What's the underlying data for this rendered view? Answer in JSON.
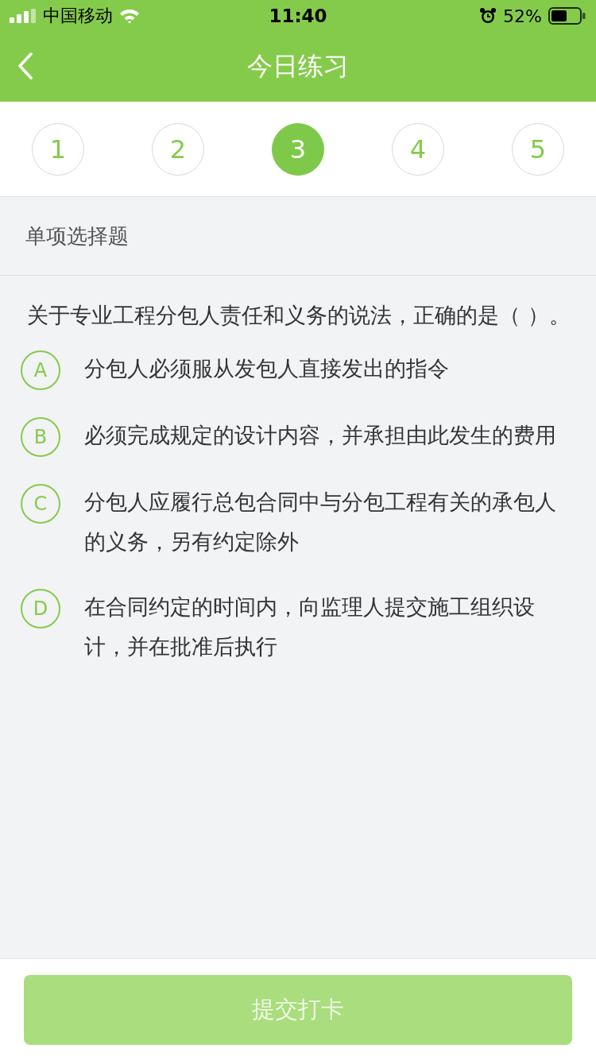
{
  "status_bar": {
    "carrier": "中国移动",
    "time": "11:40",
    "battery": "52%"
  },
  "header": {
    "title": "今日练习"
  },
  "question_nav": [
    {
      "label": "1",
      "selected": false
    },
    {
      "label": "2",
      "selected": false
    },
    {
      "label": "3",
      "selected": true
    },
    {
      "label": "4",
      "selected": false
    },
    {
      "label": "5",
      "selected": false
    }
  ],
  "question_type": "单项选择题",
  "question": "关于专业工程分包人责任和义务的说法，正确的是（   ）。",
  "options": [
    {
      "letter": "A",
      "text": "分包人必须服从发包人直接发出的指令",
      "selected": false
    },
    {
      "letter": "B",
      "text": "必须完成规定的设计内容，并承担由此发生的费用",
      "selected": false
    },
    {
      "letter": "C",
      "text": "分包人应履行总包合同中与分包工程有关的承包人的义务，另有约定除外",
      "selected": false
    },
    {
      "letter": "D",
      "text": "在合同约定的时间内，向监理人提交施工组织设计，并在批准后执行",
      "selected": false
    }
  ],
  "submit": {
    "label": "提交打卡",
    "disabled": true
  }
}
